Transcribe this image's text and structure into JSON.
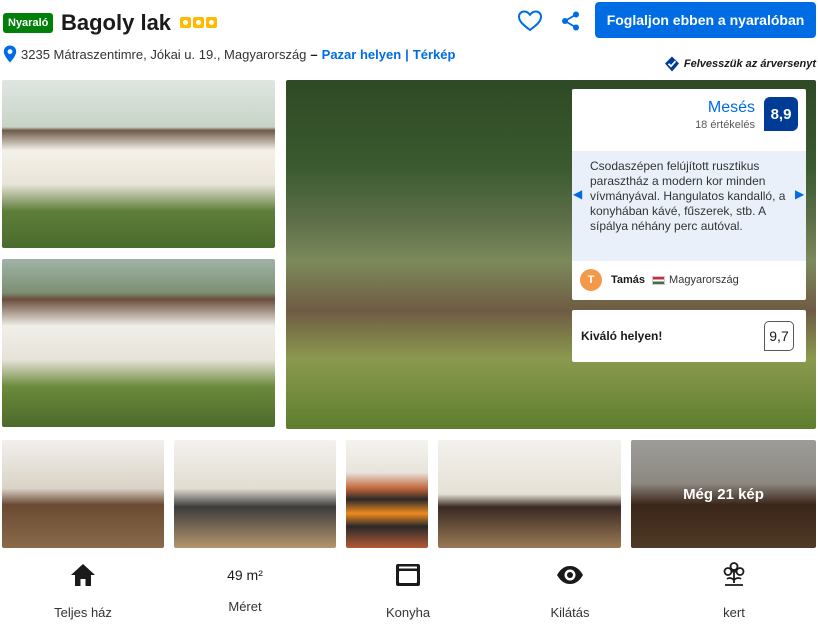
{
  "header": {
    "badge": "Nyaraló",
    "title": "Bagoly lak",
    "star_count": 3,
    "book_button": "Foglaljon ebben a nyaralóban",
    "address": "3235 Mátraszentimre, Jókai u. 19., Magyarország",
    "dash": "–",
    "location_link": "Pazar helyen",
    "separator": "|",
    "map_link": "Térkép",
    "price_match": "Felvesszük az árversenyt"
  },
  "icons": {
    "heart": "heart-icon",
    "share": "share-icon",
    "pin": "map-pin-icon",
    "price_match": "checkmark-shield-icon"
  },
  "colors": {
    "brand_blue": "#006ce4",
    "dark_blue": "#003b95",
    "badge_green": "#008009",
    "star_yellow": "#febb02"
  },
  "gallery": {
    "more_photos": "Még 21 kép"
  },
  "review": {
    "rating_word": "Mesés",
    "rating_count": "18 értékelés",
    "score": "8,9",
    "quote": "Csodaszépen felújított rusztikus parasztház a modern kor minden vívmányával. Hangulatos kandalló, a konyhában kávé, fűszerek, stb. A sípálya néhány perc autóval.",
    "reviewer_initial": "T",
    "reviewer_name": "Tamás",
    "reviewer_country": "Magyarország"
  },
  "location_score": {
    "label": "Kiváló helyen!",
    "score": "9,7"
  },
  "facilities": [
    {
      "icon": "house-icon",
      "value": "",
      "label": "Teljes ház"
    },
    {
      "icon": "",
      "value": "49 m²",
      "label": "Méret"
    },
    {
      "icon": "oven-icon",
      "value": "",
      "label": "Konyha"
    },
    {
      "icon": "eye-icon",
      "value": "",
      "label": "Kilátás"
    },
    {
      "icon": "flower-icon",
      "value": "",
      "label": "kert"
    }
  ]
}
